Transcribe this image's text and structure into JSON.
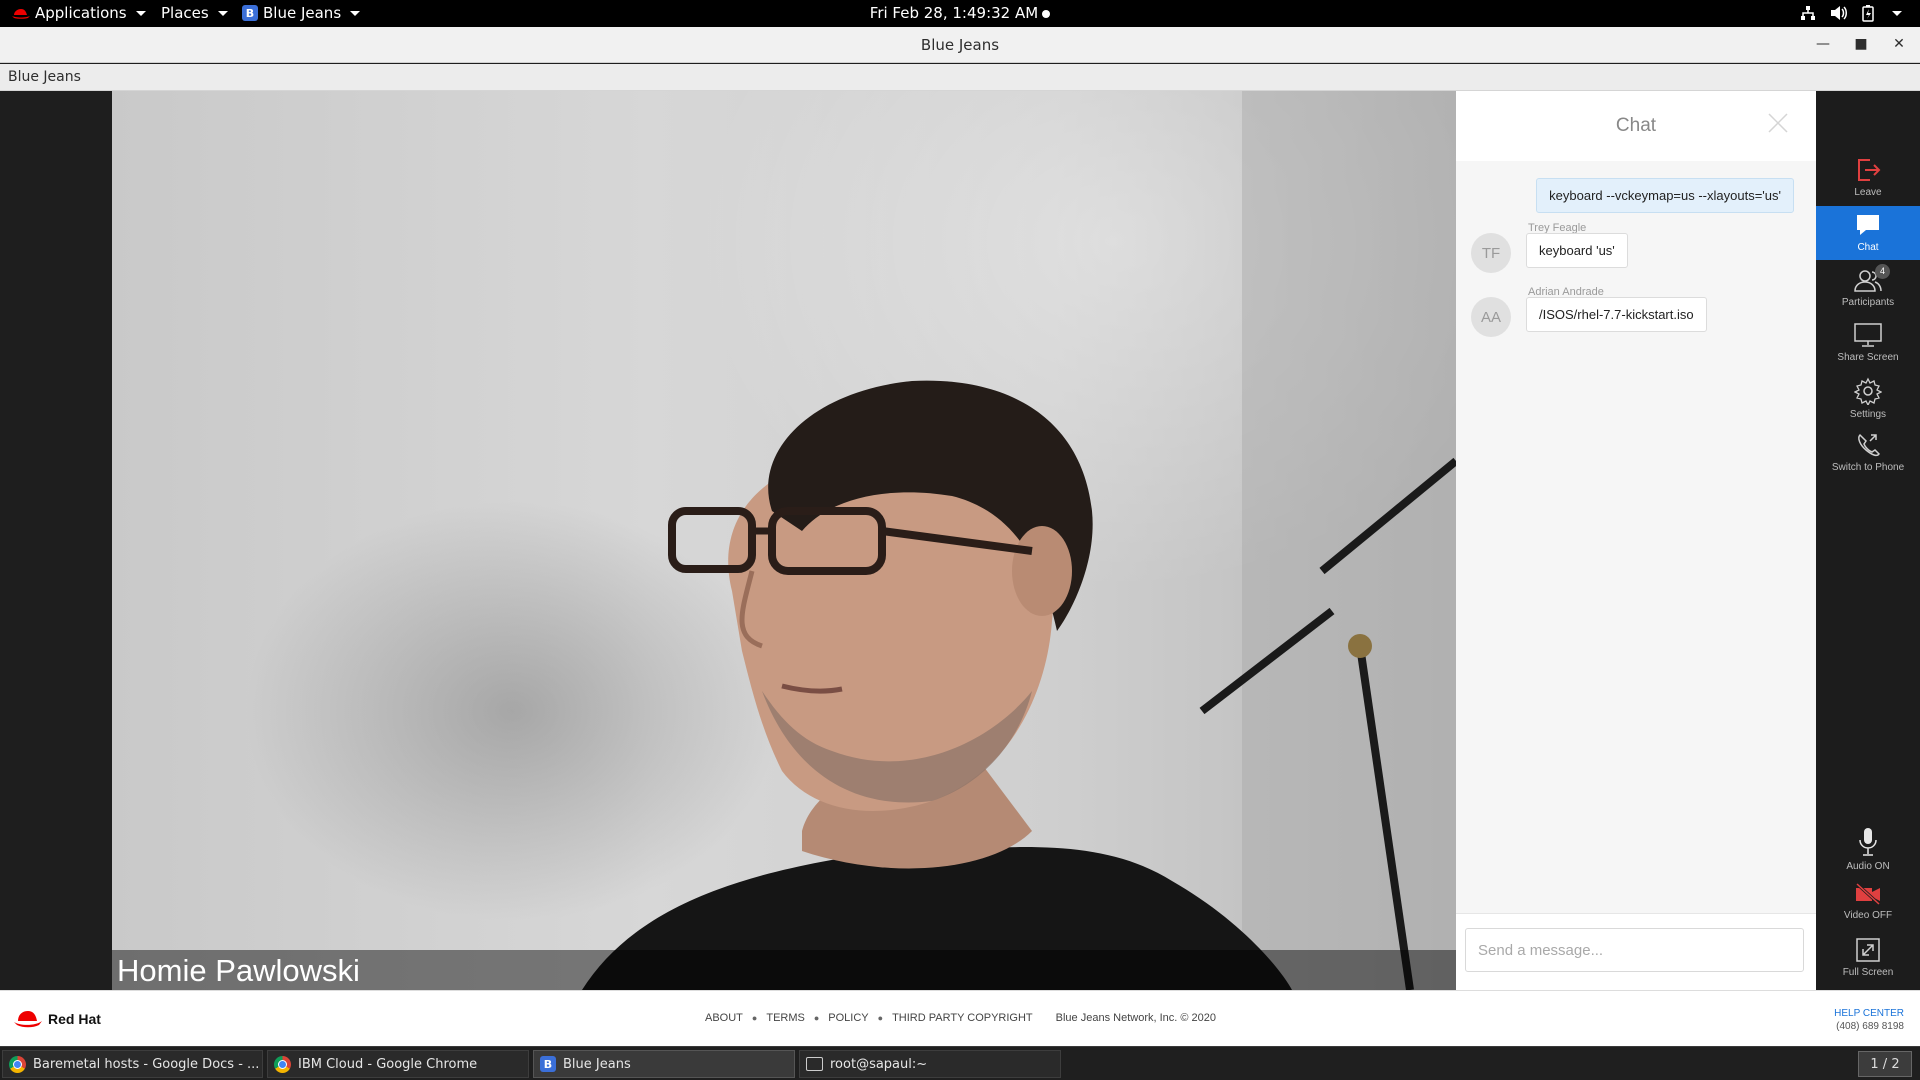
{
  "topbar": {
    "applications": "Applications",
    "places": "Places",
    "active_app": "Blue Jeans",
    "clock": "Fri Feb 28,  1:49:32 AM",
    "tray_icons": [
      "network-icon",
      "volume-icon",
      "battery-icon",
      "system-menu-icon"
    ]
  },
  "window": {
    "title": "Blue Jeans",
    "app_label": "Blue Jeans"
  },
  "video": {
    "participant_name": "Homie Pawlowski"
  },
  "chat": {
    "title": "Chat",
    "own_message": "keyboard --vckeymap=us --xlayouts='us'",
    "messages": [
      {
        "initials": "TF",
        "sender": "Trey Feagle",
        "text": "keyboard 'us'"
      },
      {
        "initials": "AA",
        "sender": "Adrian Andrade",
        "text": "/ISOS/rhel-7.7-kickstart.iso"
      }
    ],
    "input_placeholder": "Send a message..."
  },
  "rail": {
    "items": [
      {
        "label": "Leave",
        "icon": "leave-icon"
      },
      {
        "label": "Chat",
        "icon": "chat-icon",
        "active": true
      },
      {
        "label": "Participants",
        "icon": "participants-icon",
        "badge": "4"
      },
      {
        "label": "Share Screen",
        "icon": "share-screen-icon"
      },
      {
        "label": "Settings",
        "icon": "gear-icon"
      },
      {
        "label": "Switch to Phone",
        "icon": "phone-icon"
      },
      {
        "label": "Audio ON",
        "icon": "microphone-icon"
      },
      {
        "label": "Video OFF",
        "icon": "video-off-icon"
      },
      {
        "label": "Full Screen",
        "icon": "fullscreen-icon"
      }
    ],
    "colors": {
      "active": "#1a73d9",
      "leave": "#e04040",
      "video_off": "#e04040"
    }
  },
  "footer": {
    "brand": "Red Hat",
    "links": [
      "ABOUT",
      "TERMS",
      "POLICY",
      "THIRD PARTY COPYRIGHT"
    ],
    "copyright": "Blue Jeans Network, Inc. © 2020",
    "help_center": "HELP CENTER",
    "phone": "(408) 689 8198"
  },
  "taskbar": {
    "tasks": [
      {
        "label": "Baremetal hosts - Google Docs - ...",
        "icon": "chrome-icon"
      },
      {
        "label": "IBM Cloud - Google Chrome",
        "icon": "chrome-icon"
      },
      {
        "label": "Blue Jeans",
        "icon": "bluejeans-icon",
        "active": true
      },
      {
        "label": "root@sapaul:~",
        "icon": "terminal-icon"
      }
    ],
    "workspace": "1 / 2"
  }
}
